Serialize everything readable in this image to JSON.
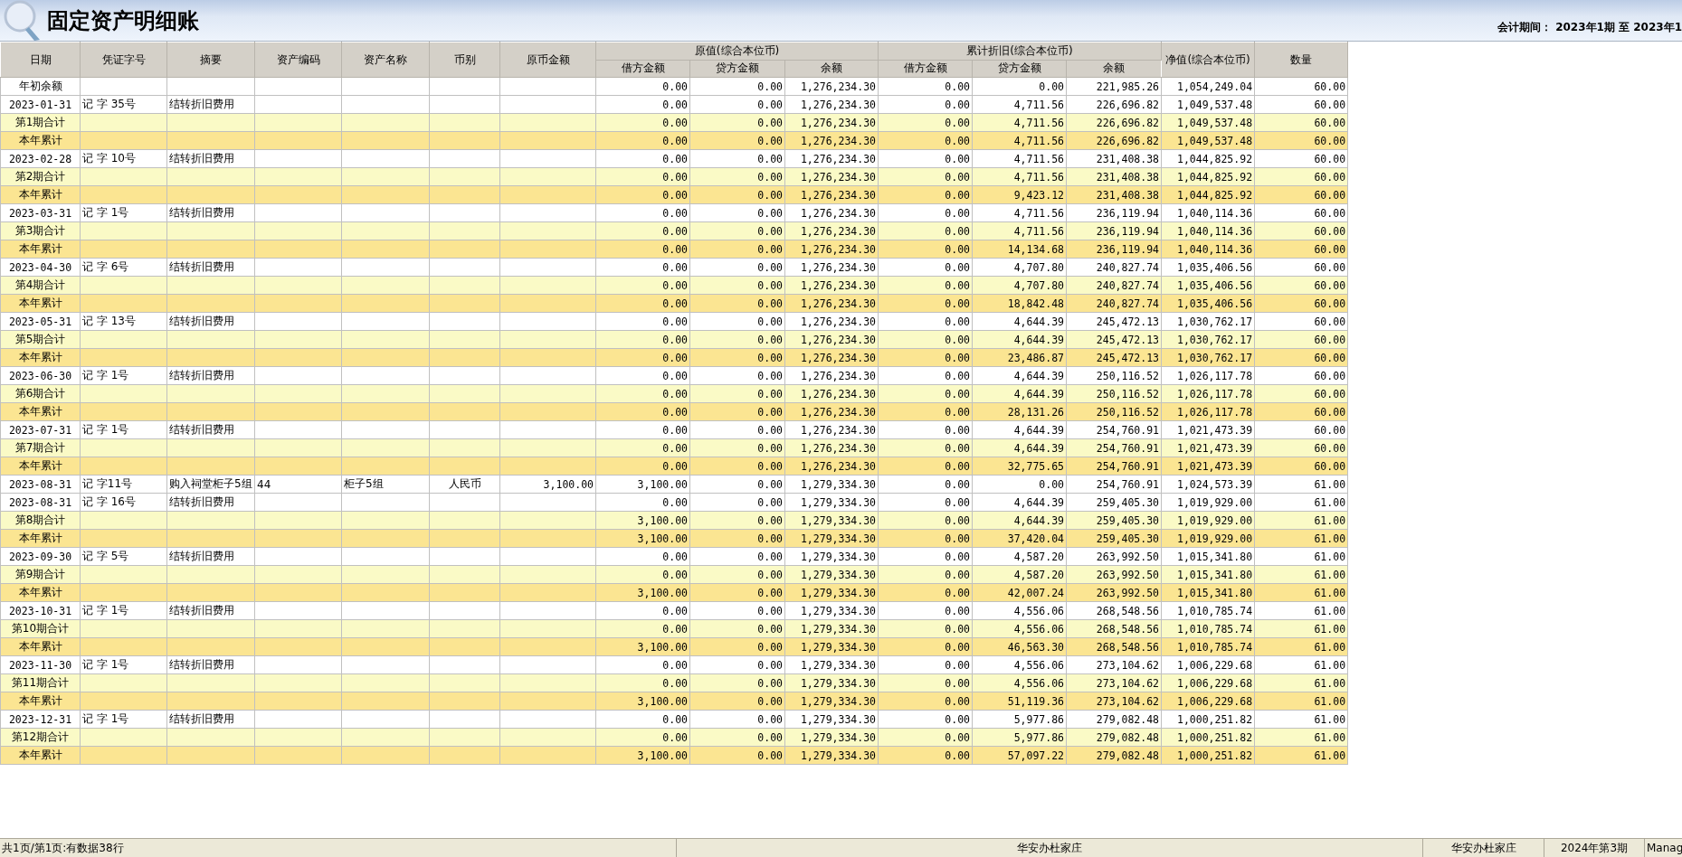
{
  "title": "固定资产明细账",
  "period": "会计期间： 2023年1期 至 2023年1",
  "columns": [
    {
      "label": "日期"
    },
    {
      "label": "凭证字号"
    },
    {
      "label": "摘要"
    },
    {
      "label": "资产编码"
    },
    {
      "label": "资产名称"
    },
    {
      "label": "币别"
    },
    {
      "label": "原币金额"
    },
    {
      "label": "原值(综合本位币)",
      "children": [
        {
          "label": "借方金额"
        },
        {
          "label": "贷方金额"
        },
        {
          "label": "余额"
        }
      ]
    },
    {
      "label": "累计折旧(综合本位币)",
      "children": [
        {
          "label": "借方金额"
        },
        {
          "label": "贷方金额"
        },
        {
          "label": "余额"
        }
      ]
    },
    {
      "label": "净值(综合本位币)"
    },
    {
      "label": "数量"
    }
  ],
  "rows": [
    {
      "kind": "opening",
      "date": "年初余额",
      "orig_debit": "0.00",
      "orig_credit": "0.00",
      "orig_balance": "1,276,234.30",
      "depr_debit": "0.00",
      "depr_credit": "0.00",
      "depr_balance": "221,985.26",
      "net_value": "1,054,249.04",
      "quantity": "60.00"
    },
    {
      "kind": "detail",
      "date": "2023-01-31",
      "voucher": "记 字 35号",
      "summary": "结转折旧费用",
      "orig_debit": "0.00",
      "orig_credit": "0.00",
      "orig_balance": "1,276,234.30",
      "depr_debit": "0.00",
      "depr_credit": "4,711.56",
      "depr_balance": "226,696.82",
      "net_value": "1,049,537.48",
      "quantity": "60.00"
    },
    {
      "kind": "period",
      "date": "第1期合计",
      "orig_debit": "0.00",
      "orig_credit": "0.00",
      "orig_balance": "1,276,234.30",
      "depr_debit": "0.00",
      "depr_credit": "4,711.56",
      "depr_balance": "226,696.82",
      "net_value": "1,049,537.48",
      "quantity": "60.00"
    },
    {
      "kind": "ytd",
      "date": "本年累计",
      "orig_debit": "0.00",
      "orig_credit": "0.00",
      "orig_balance": "1,276,234.30",
      "depr_debit": "0.00",
      "depr_credit": "4,711.56",
      "depr_balance": "226,696.82",
      "net_value": "1,049,537.48",
      "quantity": "60.00"
    },
    {
      "kind": "detail",
      "date": "2023-02-28",
      "voucher": "记 字 10号",
      "summary": "结转折旧费用",
      "orig_debit": "0.00",
      "orig_credit": "0.00",
      "orig_balance": "1,276,234.30",
      "depr_debit": "0.00",
      "depr_credit": "4,711.56",
      "depr_balance": "231,408.38",
      "net_value": "1,044,825.92",
      "quantity": "60.00"
    },
    {
      "kind": "period",
      "date": "第2期合计",
      "orig_debit": "0.00",
      "orig_credit": "0.00",
      "orig_balance": "1,276,234.30",
      "depr_debit": "0.00",
      "depr_credit": "4,711.56",
      "depr_balance": "231,408.38",
      "net_value": "1,044,825.92",
      "quantity": "60.00"
    },
    {
      "kind": "ytd",
      "date": "本年累计",
      "orig_debit": "0.00",
      "orig_credit": "0.00",
      "orig_balance": "1,276,234.30",
      "depr_debit": "0.00",
      "depr_credit": "9,423.12",
      "depr_balance": "231,408.38",
      "net_value": "1,044,825.92",
      "quantity": "60.00"
    },
    {
      "kind": "detail",
      "date": "2023-03-31",
      "voucher": "记 字 1号",
      "summary": "结转折旧费用",
      "orig_debit": "0.00",
      "orig_credit": "0.00",
      "orig_balance": "1,276,234.30",
      "depr_debit": "0.00",
      "depr_credit": "4,711.56",
      "depr_balance": "236,119.94",
      "net_value": "1,040,114.36",
      "quantity": "60.00"
    },
    {
      "kind": "period",
      "date": "第3期合计",
      "orig_debit": "0.00",
      "orig_credit": "0.00",
      "orig_balance": "1,276,234.30",
      "depr_debit": "0.00",
      "depr_credit": "4,711.56",
      "depr_balance": "236,119.94",
      "net_value": "1,040,114.36",
      "quantity": "60.00"
    },
    {
      "kind": "ytd",
      "date": "本年累计",
      "orig_debit": "0.00",
      "orig_credit": "0.00",
      "orig_balance": "1,276,234.30",
      "depr_debit": "0.00",
      "depr_credit": "14,134.68",
      "depr_balance": "236,119.94",
      "net_value": "1,040,114.36",
      "quantity": "60.00"
    },
    {
      "kind": "detail",
      "date": "2023-04-30",
      "voucher": "记 字 6号",
      "summary": "结转折旧费用",
      "orig_debit": "0.00",
      "orig_credit": "0.00",
      "orig_balance": "1,276,234.30",
      "depr_debit": "0.00",
      "depr_credit": "4,707.80",
      "depr_balance": "240,827.74",
      "net_value": "1,035,406.56",
      "quantity": "60.00"
    },
    {
      "kind": "period",
      "date": "第4期合计",
      "orig_debit": "0.00",
      "orig_credit": "0.00",
      "orig_balance": "1,276,234.30",
      "depr_debit": "0.00",
      "depr_credit": "4,707.80",
      "depr_balance": "240,827.74",
      "net_value": "1,035,406.56",
      "quantity": "60.00"
    },
    {
      "kind": "ytd",
      "date": "本年累计",
      "orig_debit": "0.00",
      "orig_credit": "0.00",
      "orig_balance": "1,276,234.30",
      "depr_debit": "0.00",
      "depr_credit": "18,842.48",
      "depr_balance": "240,827.74",
      "net_value": "1,035,406.56",
      "quantity": "60.00"
    },
    {
      "kind": "detail",
      "date": "2023-05-31",
      "voucher": "记 字 13号",
      "summary": "结转折旧费用",
      "orig_debit": "0.00",
      "orig_credit": "0.00",
      "orig_balance": "1,276,234.30",
      "depr_debit": "0.00",
      "depr_credit": "4,644.39",
      "depr_balance": "245,472.13",
      "net_value": "1,030,762.17",
      "quantity": "60.00"
    },
    {
      "kind": "period",
      "date": "第5期合计",
      "orig_debit": "0.00",
      "orig_credit": "0.00",
      "orig_balance": "1,276,234.30",
      "depr_debit": "0.00",
      "depr_credit": "4,644.39",
      "depr_balance": "245,472.13",
      "net_value": "1,030,762.17",
      "quantity": "60.00"
    },
    {
      "kind": "ytd",
      "date": "本年累计",
      "orig_debit": "0.00",
      "orig_credit": "0.00",
      "orig_balance": "1,276,234.30",
      "depr_debit": "0.00",
      "depr_credit": "23,486.87",
      "depr_balance": "245,472.13",
      "net_value": "1,030,762.17",
      "quantity": "60.00"
    },
    {
      "kind": "detail",
      "date": "2023-06-30",
      "voucher": "记 字 1号",
      "summary": "结转折旧费用",
      "orig_debit": "0.00",
      "orig_credit": "0.00",
      "orig_balance": "1,276,234.30",
      "depr_debit": "0.00",
      "depr_credit": "4,644.39",
      "depr_balance": "250,116.52",
      "net_value": "1,026,117.78",
      "quantity": "60.00"
    },
    {
      "kind": "period",
      "date": "第6期合计",
      "orig_debit": "0.00",
      "orig_credit": "0.00",
      "orig_balance": "1,276,234.30",
      "depr_debit": "0.00",
      "depr_credit": "4,644.39",
      "depr_balance": "250,116.52",
      "net_value": "1,026,117.78",
      "quantity": "60.00"
    },
    {
      "kind": "ytd",
      "date": "本年累计",
      "orig_debit": "0.00",
      "orig_credit": "0.00",
      "orig_balance": "1,276,234.30",
      "depr_debit": "0.00",
      "depr_credit": "28,131.26",
      "depr_balance": "250,116.52",
      "net_value": "1,026,117.78",
      "quantity": "60.00"
    },
    {
      "kind": "detail",
      "date": "2023-07-31",
      "voucher": "记 字 1号",
      "summary": "结转折旧费用",
      "orig_debit": "0.00",
      "orig_credit": "0.00",
      "orig_balance": "1,276,234.30",
      "depr_debit": "0.00",
      "depr_credit": "4,644.39",
      "depr_balance": "254,760.91",
      "net_value": "1,021,473.39",
      "quantity": "60.00"
    },
    {
      "kind": "period",
      "date": "第7期合计",
      "orig_debit": "0.00",
      "orig_credit": "0.00",
      "orig_balance": "1,276,234.30",
      "depr_debit": "0.00",
      "depr_credit": "4,644.39",
      "depr_balance": "254,760.91",
      "net_value": "1,021,473.39",
      "quantity": "60.00"
    },
    {
      "kind": "ytd",
      "date": "本年累计",
      "orig_debit": "0.00",
      "orig_credit": "0.00",
      "orig_balance": "1,276,234.30",
      "depr_debit": "0.00",
      "depr_credit": "32,775.65",
      "depr_balance": "254,760.91",
      "net_value": "1,021,473.39",
      "quantity": "60.00"
    },
    {
      "kind": "detail",
      "date": "2023-08-31",
      "voucher": "记 字11号",
      "summary": "购入祠堂柜子5组",
      "asset_code": "44",
      "asset_name": "柜子5组",
      "currency": "人民币",
      "original_amount": "3,100.00",
      "orig_debit": "3,100.00",
      "orig_credit": "0.00",
      "orig_balance": "1,279,334.30",
      "depr_debit": "0.00",
      "depr_credit": "0.00",
      "depr_balance": "254,760.91",
      "net_value": "1,024,573.39",
      "quantity": "61.00"
    },
    {
      "kind": "detail",
      "date": "2023-08-31",
      "voucher": "记 字 16号",
      "summary": "结转折旧费用",
      "orig_debit": "0.00",
      "orig_credit": "0.00",
      "orig_balance": "1,279,334.30",
      "depr_debit": "0.00",
      "depr_credit": "4,644.39",
      "depr_balance": "259,405.30",
      "net_value": "1,019,929.00",
      "quantity": "61.00"
    },
    {
      "kind": "period",
      "date": "第8期合计",
      "orig_debit": "3,100.00",
      "orig_credit": "0.00",
      "orig_balance": "1,279,334.30",
      "depr_debit": "0.00",
      "depr_credit": "4,644.39",
      "depr_balance": "259,405.30",
      "net_value": "1,019,929.00",
      "quantity": "61.00"
    },
    {
      "kind": "ytd",
      "date": "本年累计",
      "orig_debit": "3,100.00",
      "orig_credit": "0.00",
      "orig_balance": "1,279,334.30",
      "depr_debit": "0.00",
      "depr_credit": "37,420.04",
      "depr_balance": "259,405.30",
      "net_value": "1,019,929.00",
      "quantity": "61.00"
    },
    {
      "kind": "detail",
      "date": "2023-09-30",
      "voucher": "记 字 5号",
      "summary": "结转折旧费用",
      "orig_debit": "0.00",
      "orig_credit": "0.00",
      "orig_balance": "1,279,334.30",
      "depr_debit": "0.00",
      "depr_credit": "4,587.20",
      "depr_balance": "263,992.50",
      "net_value": "1,015,341.80",
      "quantity": "61.00"
    },
    {
      "kind": "period",
      "date": "第9期合计",
      "orig_debit": "0.00",
      "orig_credit": "0.00",
      "orig_balance": "1,279,334.30",
      "depr_debit": "0.00",
      "depr_credit": "4,587.20",
      "depr_balance": "263,992.50",
      "net_value": "1,015,341.80",
      "quantity": "61.00"
    },
    {
      "kind": "ytd",
      "date": "本年累计",
      "orig_debit": "3,100.00",
      "orig_credit": "0.00",
      "orig_balance": "1,279,334.30",
      "depr_debit": "0.00",
      "depr_credit": "42,007.24",
      "depr_balance": "263,992.50",
      "net_value": "1,015,341.80",
      "quantity": "61.00"
    },
    {
      "kind": "detail",
      "date": "2023-10-31",
      "voucher": "记 字 1号",
      "summary": "结转折旧费用",
      "orig_debit": "0.00",
      "orig_credit": "0.00",
      "orig_balance": "1,279,334.30",
      "depr_debit": "0.00",
      "depr_credit": "4,556.06",
      "depr_balance": "268,548.56",
      "net_value": "1,010,785.74",
      "quantity": "61.00"
    },
    {
      "kind": "period",
      "date": "第10期合计",
      "orig_debit": "0.00",
      "orig_credit": "0.00",
      "orig_balance": "1,279,334.30",
      "depr_debit": "0.00",
      "depr_credit": "4,556.06",
      "depr_balance": "268,548.56",
      "net_value": "1,010,785.74",
      "quantity": "61.00"
    },
    {
      "kind": "ytd",
      "date": "本年累计",
      "orig_debit": "3,100.00",
      "orig_credit": "0.00",
      "orig_balance": "1,279,334.30",
      "depr_debit": "0.00",
      "depr_credit": "46,563.30",
      "depr_balance": "268,548.56",
      "net_value": "1,010,785.74",
      "quantity": "61.00"
    },
    {
      "kind": "detail",
      "date": "2023-11-30",
      "voucher": "记 字 1号",
      "summary": "结转折旧费用",
      "orig_debit": "0.00",
      "orig_credit": "0.00",
      "orig_balance": "1,279,334.30",
      "depr_debit": "0.00",
      "depr_credit": "4,556.06",
      "depr_balance": "273,104.62",
      "net_value": "1,006,229.68",
      "quantity": "61.00"
    },
    {
      "kind": "period",
      "date": "第11期合计",
      "orig_debit": "0.00",
      "orig_credit": "0.00",
      "orig_balance": "1,279,334.30",
      "depr_debit": "0.00",
      "depr_credit": "4,556.06",
      "depr_balance": "273,104.62",
      "net_value": "1,006,229.68",
      "quantity": "61.00"
    },
    {
      "kind": "ytd",
      "date": "本年累计",
      "orig_debit": "3,100.00",
      "orig_credit": "0.00",
      "orig_balance": "1,279,334.30",
      "depr_debit": "0.00",
      "depr_credit": "51,119.36",
      "depr_balance": "273,104.62",
      "net_value": "1,006,229.68",
      "quantity": "61.00"
    },
    {
      "kind": "detail",
      "date": "2023-12-31",
      "voucher": "记 字 1号",
      "summary": "结转折旧费用",
      "orig_debit": "0.00",
      "orig_credit": "0.00",
      "orig_balance": "1,279,334.30",
      "depr_debit": "0.00",
      "depr_credit": "5,977.86",
      "depr_balance": "279,082.48",
      "net_value": "1,000,251.82",
      "quantity": "61.00"
    },
    {
      "kind": "period",
      "date": "第12期合计",
      "orig_debit": "0.00",
      "orig_credit": "0.00",
      "orig_balance": "1,279,334.30",
      "depr_debit": "0.00",
      "depr_credit": "5,977.86",
      "depr_balance": "279,082.48",
      "net_value": "1,000,251.82",
      "quantity": "61.00"
    },
    {
      "kind": "ytd",
      "date": "本年累计",
      "orig_debit": "3,100.00",
      "orig_credit": "0.00",
      "orig_balance": "1,279,334.30",
      "depr_debit": "0.00",
      "depr_credit": "57,097.22",
      "depr_balance": "279,082.48",
      "net_value": "1,000,251.82",
      "quantity": "61.00"
    }
  ],
  "status_bar": {
    "page_info": "共1页/第1页:有数据38行",
    "org_center": "华安办杜家庄",
    "org": "华安办杜家庄",
    "period": "2024年第3期",
    "user": "Manag"
  }
}
